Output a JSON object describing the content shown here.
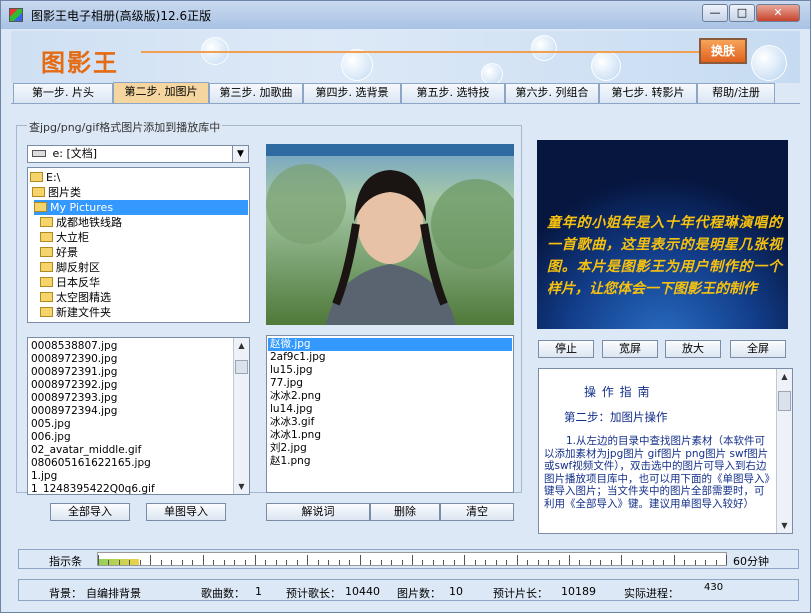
{
  "window": {
    "title": "图影王电子相册(高级版)12.6正版",
    "min": "—",
    "max": "□",
    "close": "✕"
  },
  "banner": {
    "logo": "图影王",
    "switch": "换肤"
  },
  "tabs": [
    "第一步. 片头",
    "第二步. 加图片",
    "第三步. 加歌曲",
    "第四步. 选背景",
    "第五步. 选特技",
    "第六步. 列组合",
    "第七步. 转影片",
    "帮助/注册"
  ],
  "active_tab": 1,
  "group_title": "查jpg/png/gif格式图片添加到播放库中",
  "drive": "e: [文档]",
  "tree": [
    "E:\\",
    "图片类",
    "My Pictures",
    "成都地铁线路",
    "大立柜",
    "好景",
    "脚反射区",
    "日本反华",
    "太空图精选",
    "新建文件夹"
  ],
  "files": [
    "0008538807.jpg",
    "0008972390.jpg",
    "0008972391.jpg",
    "0008972392.jpg",
    "0008972393.jpg",
    "0008972394.jpg",
    "005.jpg",
    "006.jpg",
    "02_avatar_middle.gif",
    "080605161622165.jpg",
    "1.jpg",
    "1_1248395422Q0q6.gif"
  ],
  "playlist": [
    "赵微.jpg",
    "2af9c1.jpg",
    "lu15.jpg",
    "77.jpg",
    "冰冰2.png",
    "lu14.jpg",
    "冰冰3.gif",
    "冰冰1.png",
    "刘2.jpg",
    "赵1.png"
  ],
  "buttons": {
    "import_all": "全部导入",
    "import_one": "单图导入",
    "caption": "解说词",
    "delete": "删除",
    "clear": "清空",
    "stop": "停止",
    "wide": "宽屏",
    "zoom": "放大",
    "fullscreen": "全屏"
  },
  "film_text": "童年的小姐年是入十年代程琳演唱的一首歌曲，这里表示的是明星几张视图。本片是图影王为用户制作的一个样片，让您体会一下图影王的制作",
  "guide": {
    "title": "操 作 指 南",
    "step": "第二步：加图片操作",
    "body": "1.从左边的目录中查找图片素材（本软件可以添加素材为jpg图片 gif图片 png图片 swf图片或swf视频文件），双击选中的图片可导入到右边图片播放项目库中，也可以用下面的《单图导入》键导入图片；当文件夹中的图片全部需要时，可利用《全部导入》键。建议用单图导入较好）"
  },
  "indicator": {
    "label": "指示条",
    "max_label": "60分钟",
    "progress": 0.065
  },
  "status": {
    "bg_label": "背景：",
    "bg_value": "自编排背景",
    "songs_label": "歌曲数：",
    "songs_value": "1",
    "song_len_label": "预计歌长：",
    "song_len_value": "10440",
    "pics_label": "图片数：",
    "pics_value": "10",
    "film_len_label": "预计片长：",
    "film_len_value": "10189",
    "actual_label": "实际进程：",
    "actual_value": "430"
  }
}
